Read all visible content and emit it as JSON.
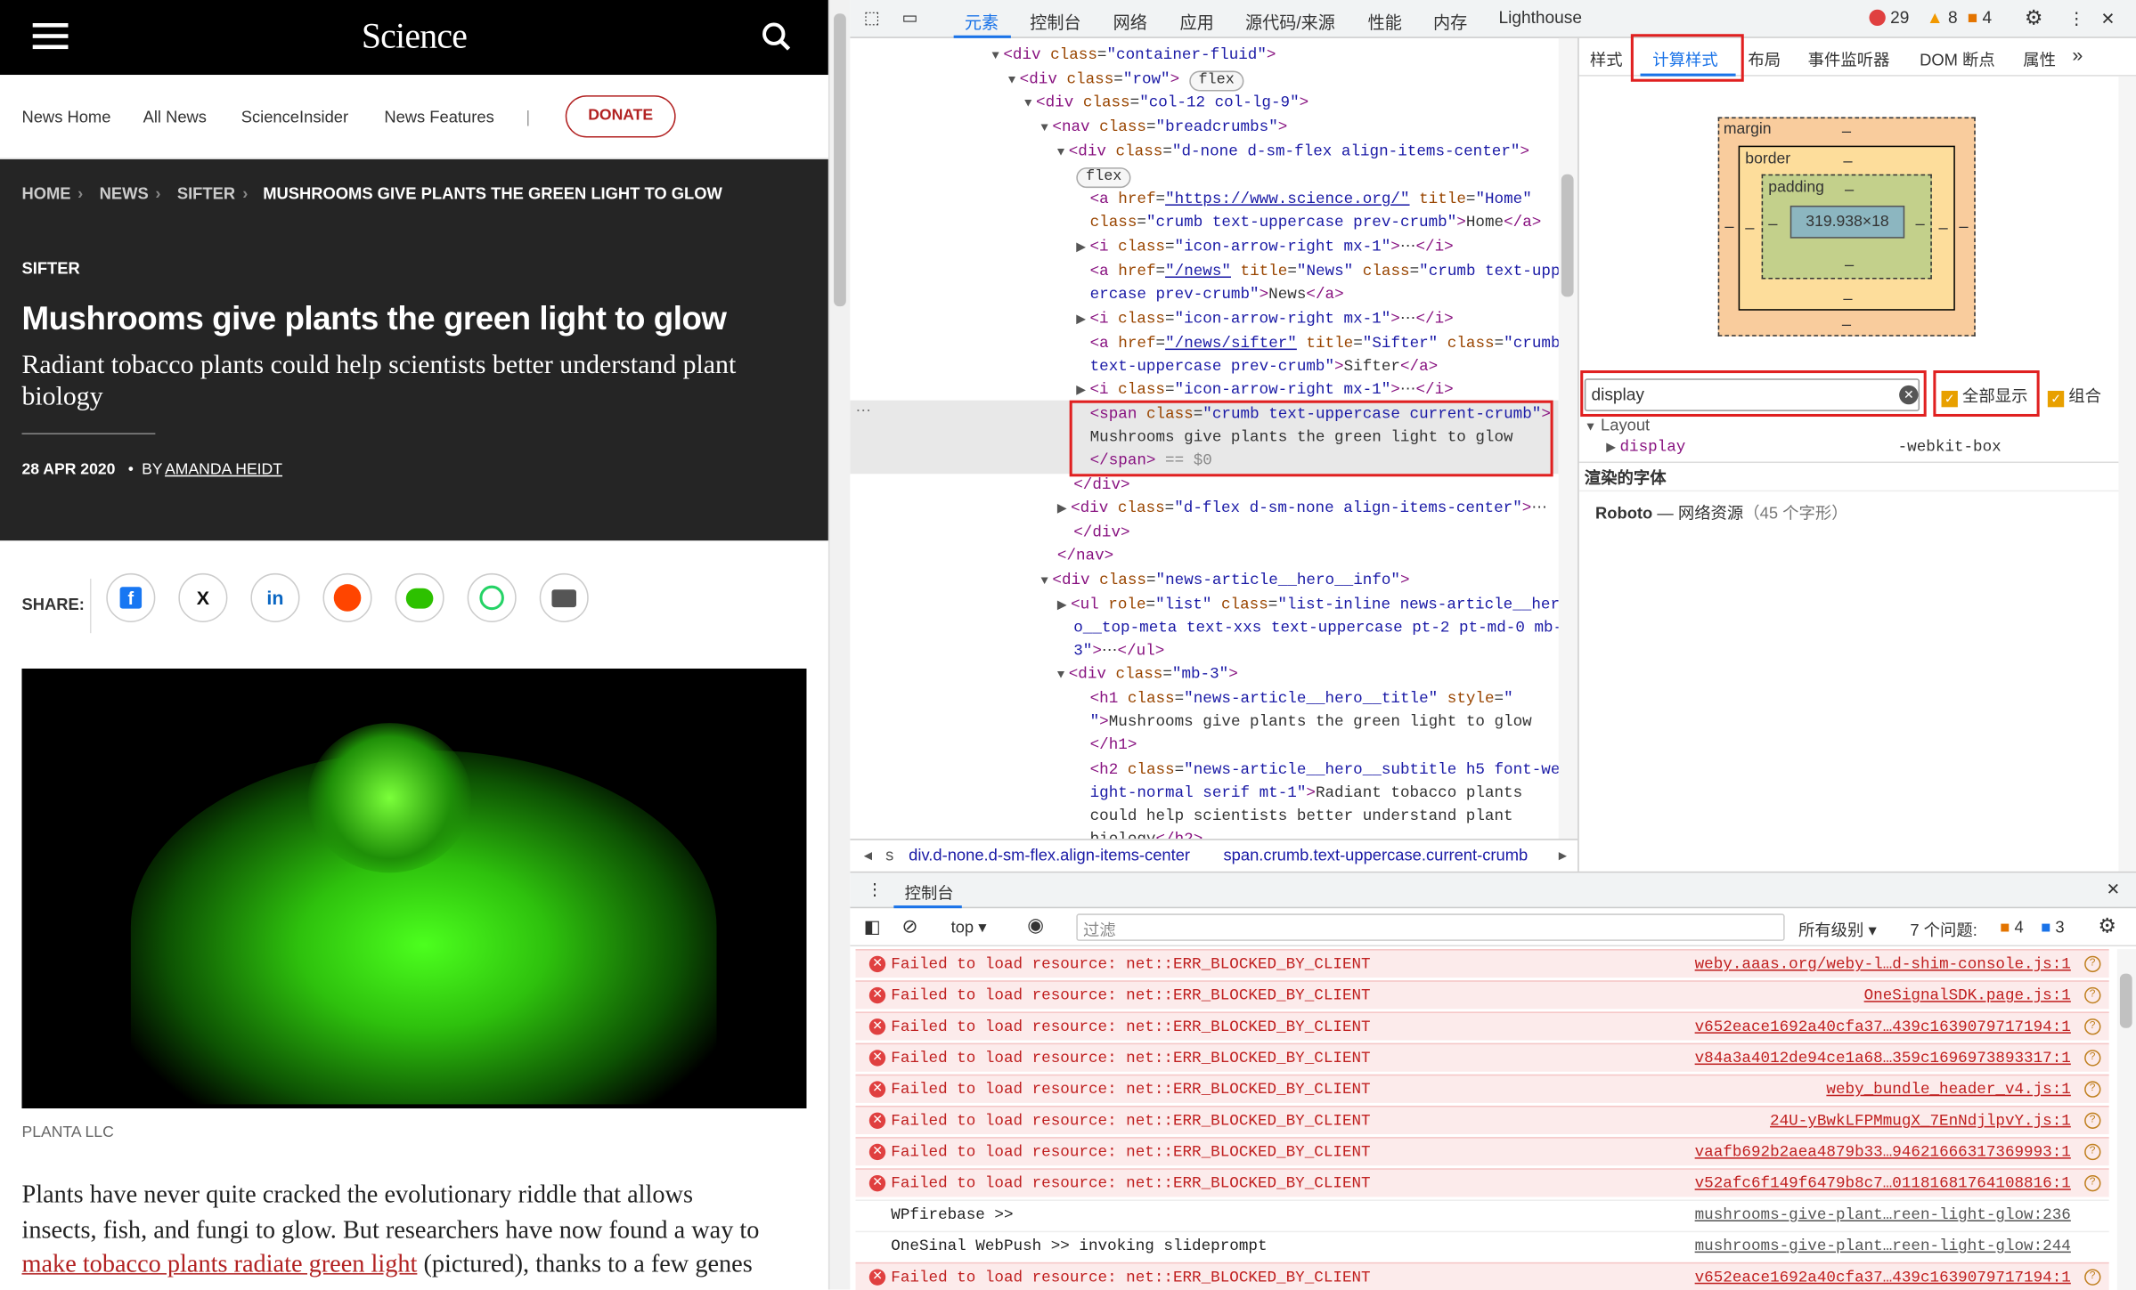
{
  "site": {
    "logo": "Science"
  },
  "nav": {
    "links": [
      "News Home",
      "All News",
      "ScienceInsider",
      "News Features"
    ],
    "sep": "|",
    "donate": "DONATE"
  },
  "breadcrumb": {
    "home": "HOME",
    "news": "NEWS",
    "sifter": "SIFTER",
    "current": "MUSHROOMS GIVE PLANTS THE GREEN LIGHT TO GLOW"
  },
  "article": {
    "section": "SIFTER",
    "title": "Mushrooms give plants the green light to glow",
    "subtitle": "Radiant tobacco plants could help scientists better understand plant biology",
    "date": "28 APR 2020",
    "by": "BY",
    "author": "AMANDA HEIDT",
    "share": "SHARE:",
    "credit": "PLANTA LLC",
    "body1": "Plants have never quite cracked the evolutionary riddle that allows",
    "body2": "insects, fish, and fungi to glow. But researchers have now found a way to",
    "body_link": "make tobacco plants radiate green light",
    "body3": " (pictured), thanks to a few genes"
  },
  "devtools": {
    "tabs": [
      "元素",
      "控制台",
      "网络",
      "应用",
      "源代码/来源",
      "性能",
      "内存",
      "Lighthouse"
    ],
    "counts": {
      "errors": "29",
      "warnings": "8",
      "info": "4"
    },
    "side_tabs": [
      "样式",
      "计算样式",
      "布局",
      "事件监听器",
      "DOM 断点",
      "属性"
    ],
    "box": {
      "margin": "margin",
      "border": "border",
      "padding": "padding",
      "content": "319.938×18",
      "dash": "–"
    },
    "filter": {
      "value": "display",
      "show_all": "全部显示",
      "group": "组合"
    },
    "layout_group": "Layout",
    "prop": {
      "name": "display",
      "value": "-webkit-box"
    },
    "fonts_title": "渲染的字体",
    "font": {
      "name": "Roboto",
      "dash": "—",
      "source": "网络资源",
      "count": "（45 个字形）"
    },
    "path": [
      "div.d-none.d-sm-flex.align-items-center",
      "span.crumb.text-uppercase.current-crumb"
    ],
    "console": {
      "title": "控制台",
      "context": "top",
      "filter_placeholder": "过滤",
      "levels": "所有级别",
      "issues": "7 个问题:",
      "issue_a": "4",
      "issue_b": "3",
      "rows": [
        {
          "type": "error",
          "msg": "Failed to load resource: net::ERR_BLOCKED_BY_CLIENT",
          "src": "weby.aaas.org/weby-l…d-shim-console.js:1"
        },
        {
          "type": "error",
          "msg": "Failed to load resource: net::ERR_BLOCKED_BY_CLIENT",
          "src": "OneSignalSDK.page.js:1"
        },
        {
          "type": "error",
          "msg": "Failed to load resource: net::ERR_BLOCKED_BY_CLIENT",
          "src": "v652eace1692a40cfa37…439c1639079717194:1"
        },
        {
          "type": "error",
          "msg": "Failed to load resource: net::ERR_BLOCKED_BY_CLIENT",
          "src": "v84a3a4012de94ce1a68…359c1696973893317:1"
        },
        {
          "type": "error",
          "msg": "Failed to load resource: net::ERR_BLOCKED_BY_CLIENT",
          "src": "weby_bundle_header_v4.js:1"
        },
        {
          "type": "error",
          "msg": "Failed to load resource: net::ERR_BLOCKED_BY_CLIENT",
          "src": "24U-yBwkLFPMmugX_7EnNdjlpvY.js:1"
        },
        {
          "type": "error",
          "msg": "Failed to load resource: net::ERR_BLOCKED_BY_CLIENT",
          "src": "vaafb692b2aea4879b33…94621666317369993:1"
        },
        {
          "type": "error",
          "msg": "Failed to load resource: net::ERR_BLOCKED_BY_CLIENT",
          "src": "v52afc6f149f6479b8c7…01181681764108816:1"
        },
        {
          "type": "log",
          "msg": "WPfirebase >>",
          "src": "mushrooms-give-plant…reen-light-glow:236"
        },
        {
          "type": "log",
          "msg": "OneSinal WebPush >> invoking slideprompt",
          "src": "mushrooms-give-plant…reen-light-glow:244"
        },
        {
          "type": "error",
          "msg": "Failed to load resource: net::ERR_BLOCKED_BY_CLIENT",
          "src": "v652eace1692a40cfa37…439c1639079717194:1"
        }
      ]
    }
  }
}
